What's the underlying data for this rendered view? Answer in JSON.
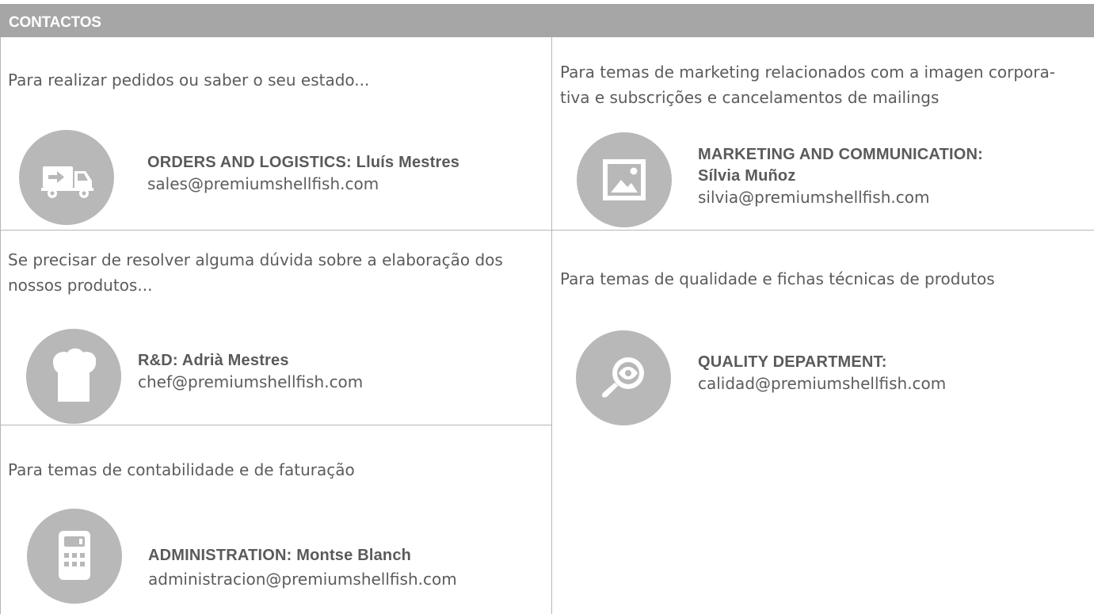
{
  "header": {
    "title": "CONTACTOS"
  },
  "contacts": [
    {
      "description": "Para realizar pedidos ou saber o seu estado...",
      "name_line1": "ORDERS AND LOGISTICS: Lluís Mestres",
      "name_line2": "",
      "email": "sales@premiumshellfish.com",
      "icon": "delivery-truck-icon"
    },
    {
      "description_line1": "Para temas de marketing relacionados com a imagen corpora-",
      "description_line2": "tiva e subscrições e cancelamentos de mailings",
      "name_line1": "MARKETING AND COMMUNICATION:",
      "name_line2": "Sílvia Muñoz",
      "email": "silvia@premiumshellfish.com",
      "icon": "image-picture-icon"
    },
    {
      "description_line1": "Se precisar de resolver alguma dúvida sobre a elaboração dos",
      "description_line2": "nossos produtos...",
      "name_line1": "R&D: Adrià Mestres",
      "name_line2": "",
      "email": "chef@premiumshellfish.com",
      "icon": "chef-hat-icon"
    },
    {
      "description": "Para temas de qualidade e fichas técnicas de produtos",
      "name_line1": "QUALITY DEPARTMENT:",
      "name_line2": "",
      "email": "calidad@premiumshellfish.com",
      "icon": "magnifier-eye-icon"
    },
    {
      "description": "Para temas de contabilidade e de faturação",
      "name_line1": "ADMINISTRATION: Montse Blanch",
      "name_line2": "",
      "email": "administracion@premiumshellfish.com",
      "icon": "calculator-icon"
    }
  ],
  "colors": {
    "header_bg": "#a6a6a6",
    "icon_bg": "#b8b8b8",
    "border": "#b6b6b6",
    "text": "#5c5c5c"
  }
}
